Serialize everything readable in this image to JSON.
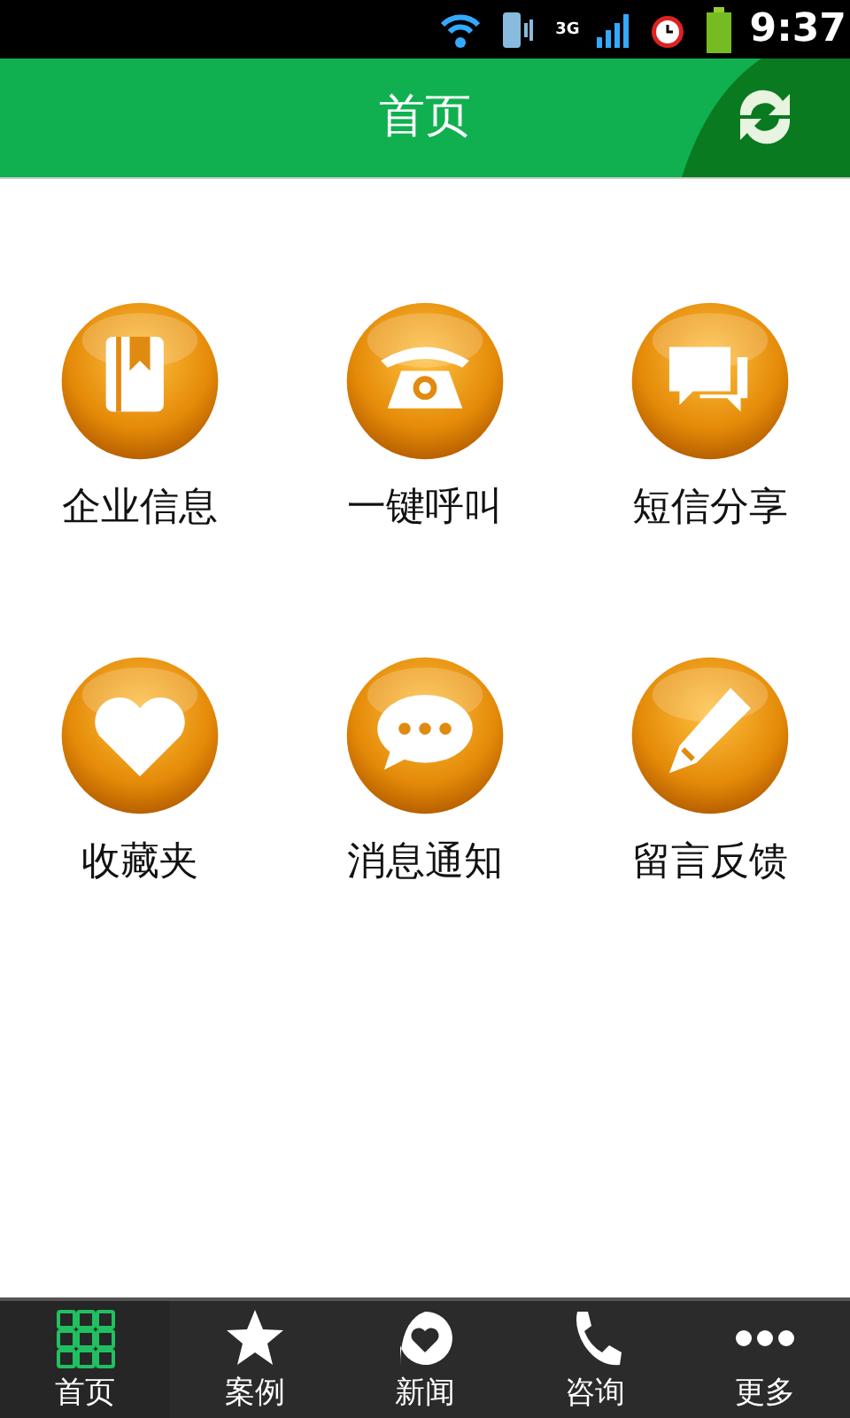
{
  "status_bar": {
    "network": "3G",
    "time": "9:37"
  },
  "header": {
    "title": "首页"
  },
  "grid": [
    {
      "kind": "book",
      "label": "企业信息"
    },
    {
      "kind": "phone",
      "label": "一键呼叫"
    },
    {
      "kind": "chat",
      "label": "短信分享"
    },
    {
      "kind": "heart",
      "label": "收藏夹"
    },
    {
      "kind": "bubble",
      "label": "消息通知"
    },
    {
      "kind": "pencil",
      "label": "留言反馈"
    }
  ],
  "tab_bar": [
    {
      "kind": "grid",
      "label": "首页",
      "selected": true
    },
    {
      "kind": "star",
      "label": "案例",
      "selected": false
    },
    {
      "kind": "news",
      "label": "新闻",
      "selected": false
    },
    {
      "kind": "call",
      "label": "咨询",
      "selected": false
    },
    {
      "kind": "more",
      "label": "更多",
      "selected": false
    }
  ]
}
